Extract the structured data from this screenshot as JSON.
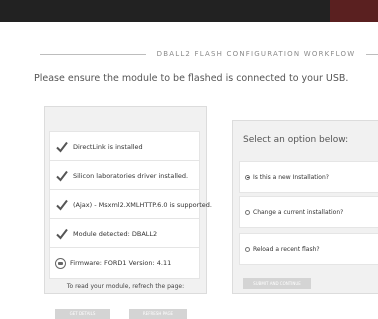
{
  "workflow_title": "DBALL2 FLASH CONFIGURATION WORKFLOW",
  "instruction": "Please ensure the module to be flashed is connected to your USB.",
  "checks": [
    "DirectLink is installed",
    "Silicon laboratories driver installed.",
    "(Ajax) - Msxml2.XMLHTTP.6.0 is supported.",
    "Module detected: DBALL2"
  ],
  "firmware": "Firmware: FORD1 Version: 4.11",
  "refresh_text": "To read your module, refrech the page:",
  "left_buttons": [
    "GET DETAILS",
    "REFRESH PAGE"
  ],
  "right": {
    "heading": "Select an option below:",
    "options": [
      {
        "label": "Is this a new Installation?",
        "selected": true
      },
      {
        "label": "Change a current installation?",
        "selected": false
      },
      {
        "label": "Reload a recent flash?",
        "selected": false
      }
    ],
    "button": "SUBMIT AND CONTINUE"
  },
  "colors": {
    "topbar": "#222222",
    "panel": "#f1f1f1",
    "check": "#555555",
    "button": "#d4d4d4"
  }
}
